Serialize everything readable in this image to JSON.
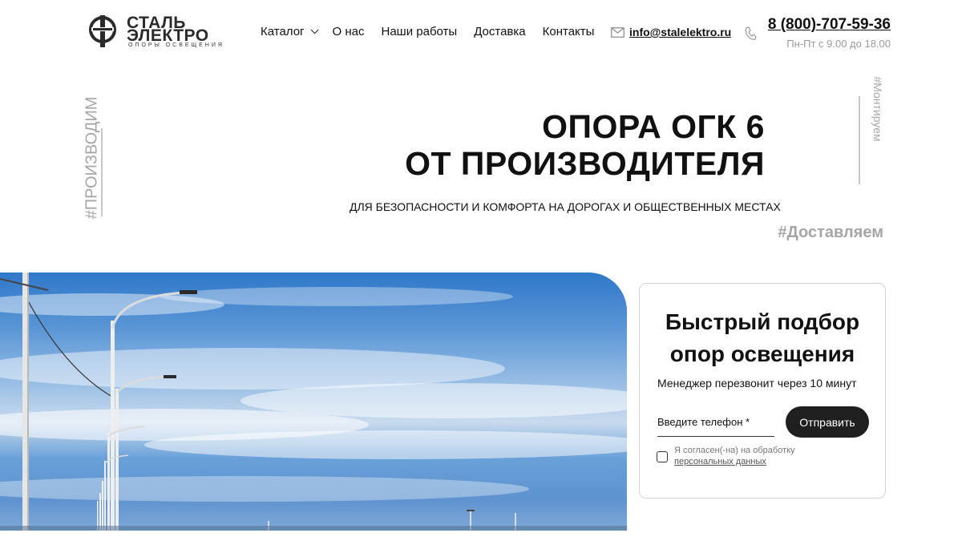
{
  "header": {
    "logo": {
      "line1": "СТАЛЬ",
      "line2": "ЭЛЕКТРО",
      "tagline": "ОПОРЫ ОСВЕЩЕНИЯ"
    },
    "nav": [
      {
        "label": "Каталог",
        "has_dropdown": true
      },
      {
        "label": "О нас"
      },
      {
        "label": "Наши работы"
      },
      {
        "label": "Доставка"
      },
      {
        "label": "Контакты"
      }
    ],
    "email": "info@stalelektro.ru",
    "phone": "8 (800)-707-59-36",
    "hours": "Пн-Пт с 9.00 до 18.00"
  },
  "hero": {
    "tag_left": "#ПРОИЗВОДИМ",
    "tag_right": "#Монтируем",
    "title_line1": "ОПОРА ОГК 6",
    "title_line2": "ОТ ПРОИЗВОДИТЕЛЯ",
    "subtitle": "ДЛЯ БЕЗОПАСНОСТИ И КОМФОРТА НА ДОРОГАХ И ОБЩЕСТВЕННЫХ МЕСТАХ",
    "tag_deliver": "#Доставляем"
  },
  "form": {
    "title_line1": "Быстрый подбор",
    "title_line2": "опор освещения",
    "subtitle": "Менеджер перезвонит через 10 минут",
    "phone_placeholder": "Введите телефон *",
    "submit_label": "Отправить",
    "consent_text": "Я согласен(-на) на обработку",
    "consent_link": "персональных данных"
  },
  "colors": {
    "accent_dark": "#1f1f1f",
    "muted_tag": "#a6a6a6",
    "sky": "#2f78c9"
  }
}
